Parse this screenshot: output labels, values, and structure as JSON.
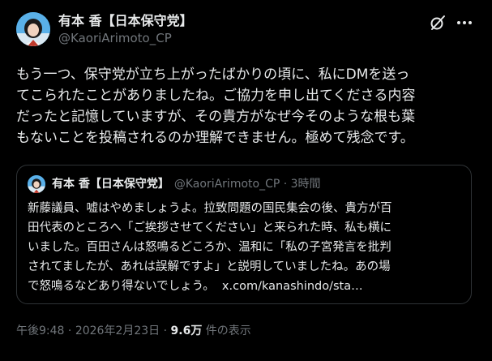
{
  "author": {
    "display_name": "有本 香【日本保守党】",
    "handle": "@KaoriArimoto_CP"
  },
  "post": {
    "lines": [
      "もう一つ、保守党が立ち上がったばかりの頃に、私にDMを送っ",
      "てこられたことがありましたね。ご協力を申し出てくださる内容",
      "だったと記憶していますが、その貴方がなぜ今そのような根も葉",
      "もないことを投稿されるのか理解できません。極めて残念です。"
    ]
  },
  "quote": {
    "display_name": "有本 香【日本保守党】",
    "handle_time": "@KaoriArimoto_CP · 3時間",
    "lines": [
      "新藤議員、嘘はやめましょうよ。拉致問題の国民集会の後、貴方が百",
      "田代表のところへ「ご挨拶させてください」と来られた時、私も横に",
      "いました。百田さんは怒鳴るどころか、温和に「私の子宮発言を批判",
      "されてましたが、あれは誤解ですよ」と説明していましたね。あの場",
      "で怒鳴るなどあり得ないでしょう。"
    ],
    "link": "x.com/kanashindo/sta…"
  },
  "meta": {
    "time": "午後9:48",
    "separator": "·",
    "date": "2026年2月23日",
    "views_count": "9.6万",
    "views_label": "件の表示"
  },
  "icons": {
    "grok": "grok-icon",
    "more": "more-icon",
    "avatar": "avatar-icon"
  },
  "colors": {
    "background": "#000000",
    "text": "#e7e9ea",
    "secondary": "#71767b",
    "border": "#2f3336"
  }
}
